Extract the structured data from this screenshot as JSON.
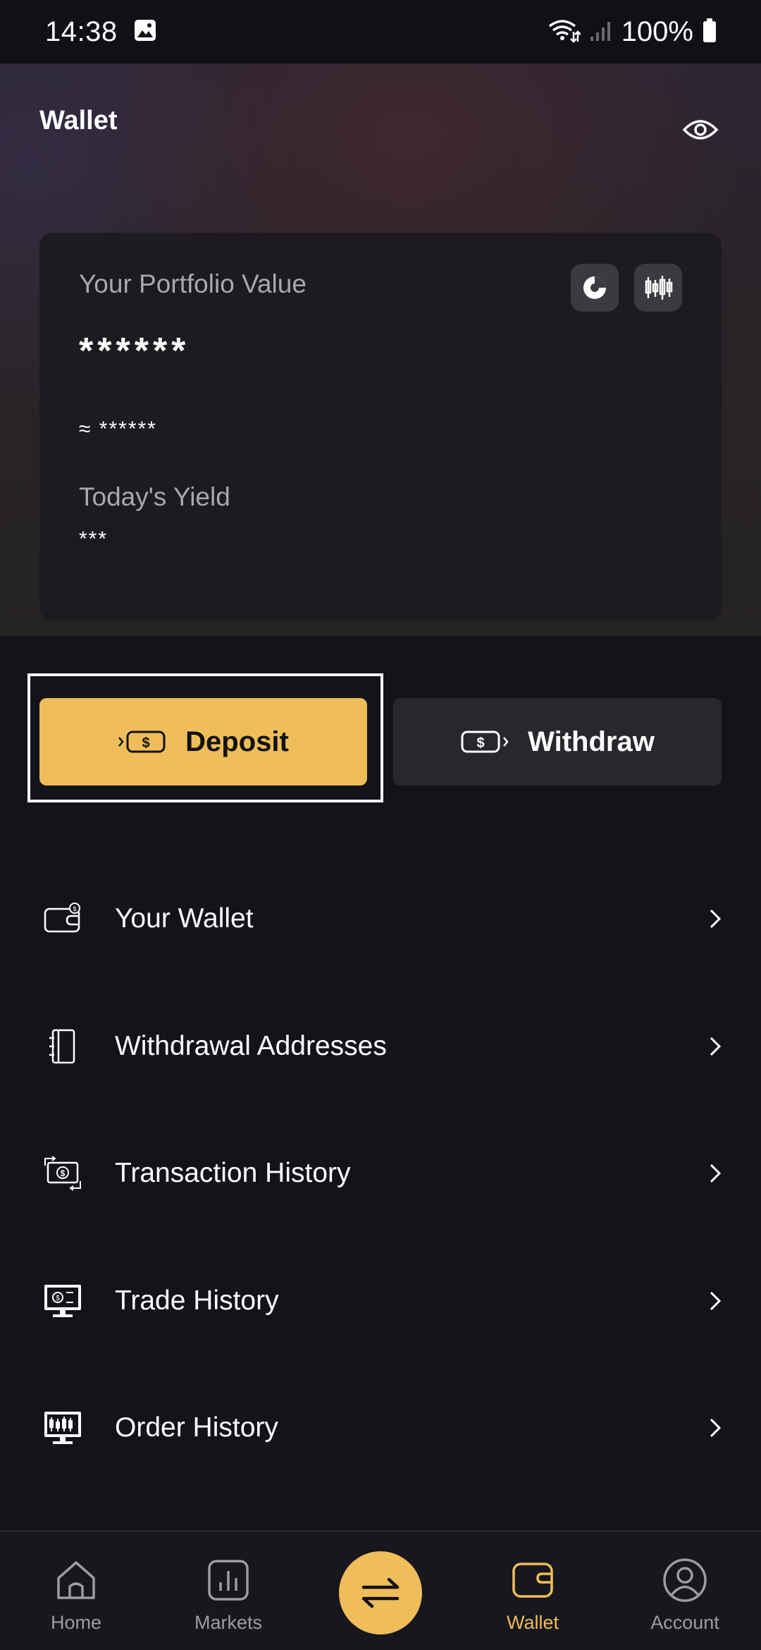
{
  "status_bar": {
    "time": "14:38",
    "battery": "100%"
  },
  "header": {
    "title": "Wallet"
  },
  "portfolio": {
    "label": "Your Portfolio Value",
    "value": "******",
    "approx": "≈ ******",
    "yield_label": "Today's Yield",
    "yield_value": "***"
  },
  "actions": {
    "deposit_label": "Deposit",
    "withdraw_label": "Withdraw"
  },
  "menu": [
    {
      "label": "Your Wallet",
      "icon": "wallet-icon"
    },
    {
      "label": "Withdrawal Addresses",
      "icon": "address-book-icon"
    },
    {
      "label": "Transaction History",
      "icon": "cash-exchange-icon"
    },
    {
      "label": "Trade History",
      "icon": "monitor-trade-icon"
    },
    {
      "label": "Order History",
      "icon": "monitor-chart-icon"
    }
  ],
  "nav": {
    "home": "Home",
    "markets": "Markets",
    "wallet": "Wallet",
    "account": "Account"
  },
  "colors": {
    "accent": "#efbd59",
    "background": "#13131a",
    "card": "#1c1a1f"
  }
}
